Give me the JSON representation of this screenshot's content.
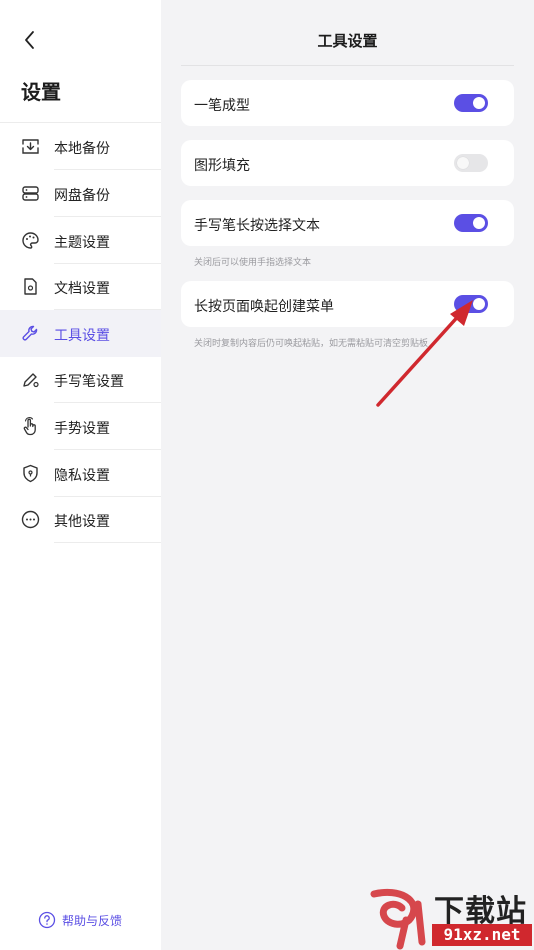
{
  "sidebar": {
    "title": "设置",
    "items": [
      {
        "label": "本地备份",
        "icon": "local-backup-icon"
      },
      {
        "label": "网盘备份",
        "icon": "cloud-backup-icon"
      },
      {
        "label": "主题设置",
        "icon": "palette-icon"
      },
      {
        "label": "文档设置",
        "icon": "document-icon"
      },
      {
        "label": "工具设置",
        "icon": "wrench-icon",
        "active": true
      },
      {
        "label": "手写笔设置",
        "icon": "pen-icon"
      },
      {
        "label": "手势设置",
        "icon": "hand-icon"
      },
      {
        "label": "隐私设置",
        "icon": "shield-icon"
      },
      {
        "label": "其他设置",
        "icon": "more-icon"
      }
    ],
    "help_label": "帮助与反馈"
  },
  "main": {
    "title": "工具设置",
    "settings": [
      {
        "label": "一笔成型",
        "on": true
      },
      {
        "label": "图形填充",
        "on": false
      },
      {
        "label": "手写笔长按选择文本",
        "on": true,
        "hint": "关闭后可以使用手指选择文本"
      },
      {
        "label": "长按页面唤起创建菜单",
        "on": true,
        "hint": "关闭时复制内容后仍可唤起粘贴，如无需粘贴可清空剪贴板"
      }
    ]
  },
  "watermark": {
    "text": "下载站",
    "url": "91xz.net"
  },
  "colors": {
    "accent": "#5b4fe4",
    "toggle_off": "#e6e6e8",
    "arrow": "#d0282e"
  }
}
